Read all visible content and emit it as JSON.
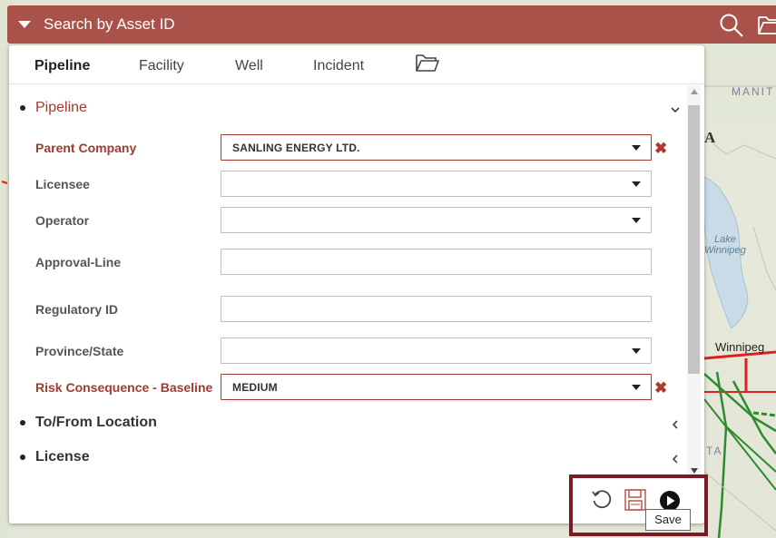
{
  "header": {
    "title": "Search by Asset ID",
    "search_icon": "search-icon",
    "folder_icon": "folder-icon",
    "color": "#a8524a"
  },
  "tabs": [
    {
      "label": "Pipeline",
      "active": true
    },
    {
      "label": "Facility",
      "active": false
    },
    {
      "label": "Well",
      "active": false
    },
    {
      "label": "Incident",
      "active": false
    }
  ],
  "tab_folder_icon": "folder-open-icon",
  "sections": {
    "pipeline": {
      "label": "Pipeline",
      "expanded": true
    },
    "to_from": {
      "label": "To/From Location",
      "expanded": false
    },
    "license": {
      "label": "License",
      "expanded": false
    }
  },
  "fields": {
    "parent_company": {
      "label": "Parent Company",
      "value": "SANLING ENERGY LTD.",
      "required": true
    },
    "licensee": {
      "label": "Licensee",
      "value": ""
    },
    "operator": {
      "label": "Operator",
      "value": ""
    },
    "approval_line": {
      "label": "Approval-Line",
      "value": ""
    },
    "regulatory_id": {
      "label": "Regulatory ID",
      "value": ""
    },
    "province_state": {
      "label": "Province/State",
      "value": ""
    },
    "risk_consequence": {
      "label": "Risk Consequence - Baseline",
      "value": "MEDIUM",
      "required": true
    }
  },
  "clear_glyph": "✖",
  "actions": {
    "reset_icon": "reset-icon",
    "save_icon": "save-icon",
    "run_icon": "play-icon",
    "tooltip": "Save"
  },
  "map": {
    "labels": {
      "province": "MANIT",
      "lake_line1": "Lake",
      "lake_line2": "Winnipeg",
      "city": "Winnipeg",
      "partial_a": "A",
      "partial_ta": "TA"
    }
  },
  "colors": {
    "required": "#a13a2f",
    "highlight": "#7a1a24"
  }
}
